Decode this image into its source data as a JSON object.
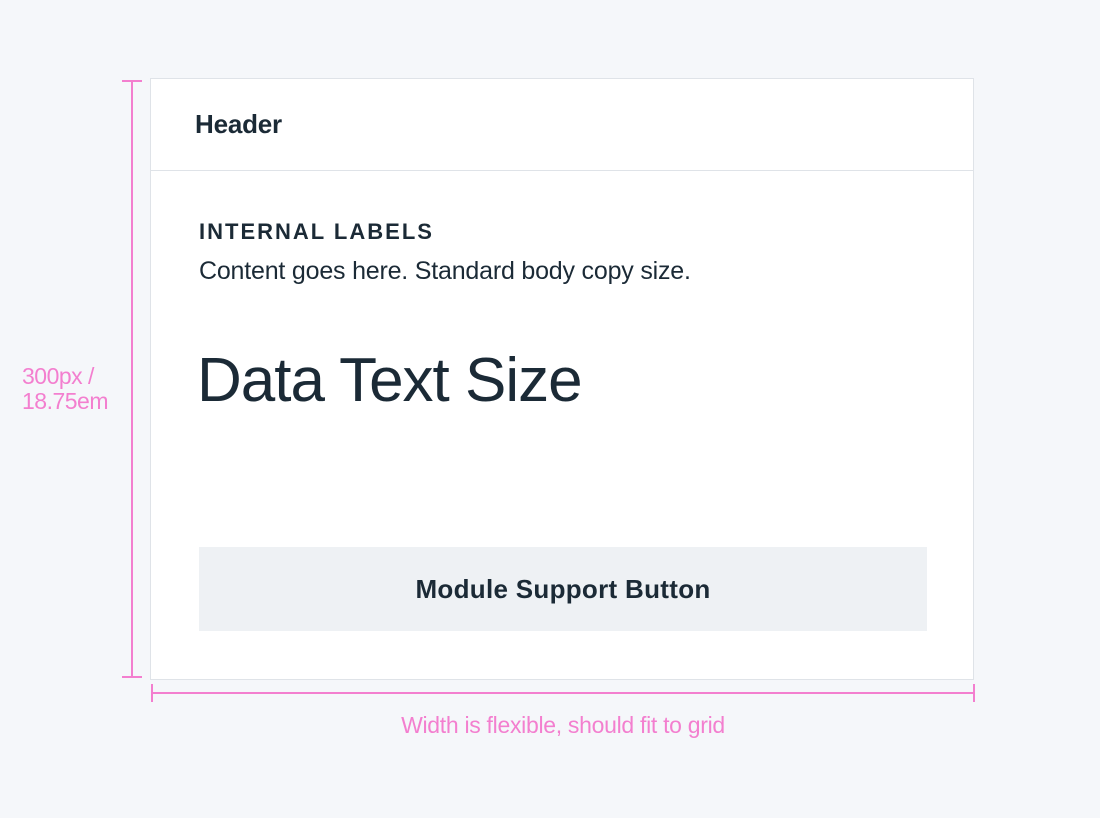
{
  "card": {
    "header_title": "Header",
    "internal_label": "INTERNAL LABELS",
    "body_copy": "Content goes here. Standard body copy size.",
    "data_text": "Data Text Size",
    "button_label": "Module Support Button"
  },
  "annotations": {
    "height_line1": "300px /",
    "height_line2": "18.75em",
    "width_note": "Width is flexible, should fit to grid"
  },
  "colors": {
    "background": "#f5f7fa",
    "card": "#ffffff",
    "text": "#1b2a36",
    "button": "#eef1f4",
    "annotation": "#f37fcf"
  }
}
